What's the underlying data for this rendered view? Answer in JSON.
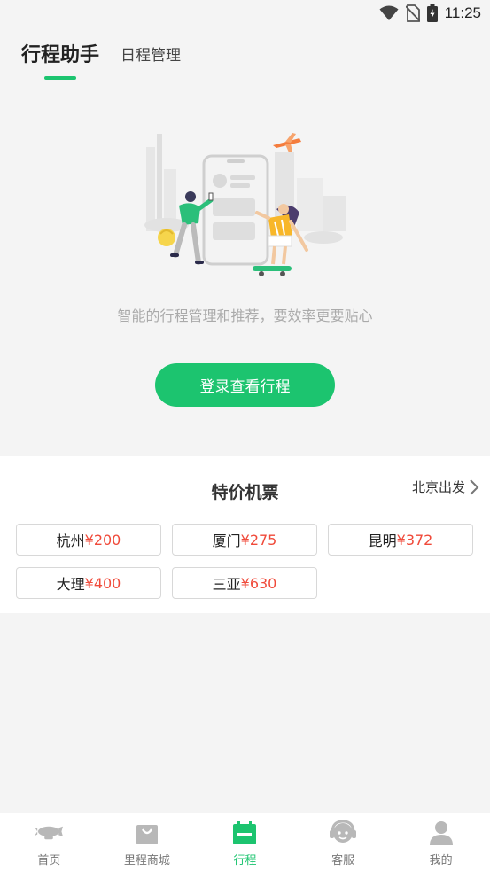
{
  "status": {
    "time": "11:25"
  },
  "tabs": {
    "main": "行程助手",
    "sub": "日程管理"
  },
  "tagline": "智能的行程管理和推荐，要效率更要贴心",
  "login_button": "登录查看行程",
  "tickets": {
    "title": "特价机票",
    "departure": "北京出发",
    "items": [
      {
        "city": "杭州",
        "price": "¥200"
      },
      {
        "city": "厦门",
        "price": "¥275"
      },
      {
        "city": "昆明",
        "price": "¥372"
      },
      {
        "city": "大理",
        "price": "¥400"
      },
      {
        "city": "三亚",
        "price": "¥630"
      }
    ]
  },
  "nav": {
    "items": [
      {
        "label": "首页",
        "icon": "airship-icon"
      },
      {
        "label": "里程商城",
        "icon": "shopping-bag-icon"
      },
      {
        "label": "行程",
        "icon": "calendar-icon",
        "active": true
      },
      {
        "label": "客服",
        "icon": "headset-icon"
      },
      {
        "label": "我的",
        "icon": "user-icon"
      }
    ]
  },
  "colors": {
    "accent": "#1cc46f",
    "price": "#f04a3a",
    "background": "#f4f4f4"
  }
}
